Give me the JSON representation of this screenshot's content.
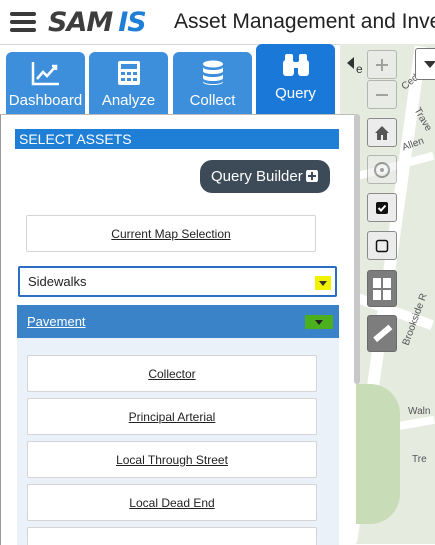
{
  "header": {
    "logo_sam": "SAM",
    "logo_is": "IS",
    "title": "Asset Management and Inve"
  },
  "tabs": [
    {
      "label": "Dashboard",
      "icon": "line-chart-icon",
      "active": false
    },
    {
      "label": "Analyze",
      "icon": "calculator-icon",
      "active": false
    },
    {
      "label": "Collect",
      "icon": "database-icon",
      "active": false
    },
    {
      "label": "Query",
      "icon": "binoculars-icon",
      "active": true
    }
  ],
  "panel": {
    "section_title": "SELECT ASSETS",
    "query_builder_label": "Query Builder",
    "current_map_selection": "Current Map Selection",
    "asset_select_value": "Sidewalks",
    "pavement_label": "Pavement",
    "options": [
      "Collector",
      "Principal Arterial",
      "Local Through Street",
      "Local Dead End"
    ]
  },
  "map": {
    "partial_text": "e",
    "labels": [
      "Cedar",
      "Trave",
      "Allen",
      "Brookside R",
      "Waln",
      "Tre"
    ]
  },
  "colors": {
    "accent_blue": "#1f7fd6",
    "tab_blue": "#3e8fdb",
    "query_builder_bg": "#3d4a57",
    "yellow_toggle": "#f2f200",
    "green_toggle": "#4caf1e"
  }
}
